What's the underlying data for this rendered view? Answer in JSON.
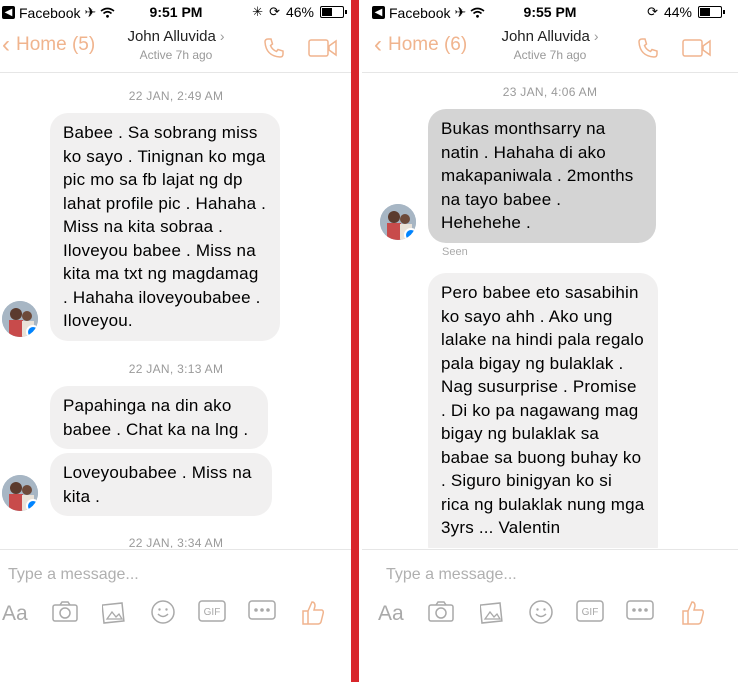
{
  "left": {
    "status": {
      "app": "Facebook",
      "time": "9:51 PM",
      "battery": "46%",
      "battery_level": 0.46
    },
    "nav": {
      "back": "Home (5)",
      "name": "John Alluvida",
      "active": "Active 7h ago"
    },
    "messages": [
      {
        "ts": "22 JAN, 2:49 AM"
      },
      {
        "text": "Babee . Sa sobrang miss ko sayo . Tinignan ko mga pic mo sa fb lajat ng dp lahat profile pic . Hahaha . Miss na kita sobraa . Iloveyou babee . Miss na kita ma txt ng magdamag . Hahaha iloveyoubabee . Iloveyou."
      },
      {
        "ts": "22 JAN, 3:13 AM"
      },
      {
        "text": "Papahinga na din ako babee . Chat ka na lng ."
      },
      {
        "text": "Loveyoubabee . Miss na kita ."
      },
      {
        "ts": "22 JAN, 3:34 AM"
      }
    ],
    "composer": {
      "placeholder": "Type a message..."
    }
  },
  "right": {
    "status": {
      "app": "Facebook",
      "time": "9:55 PM",
      "battery": "44%",
      "battery_level": 0.44
    },
    "nav": {
      "back": "Home (6)",
      "name": "John Alluvida",
      "active": "Active 7h ago"
    },
    "messages": [
      {
        "ts": "23 JAN, 4:06 AM"
      },
      {
        "text": "Bukas monthsarry na natin . Hahaha di ako makapaniwala . 2months na tayo babee . Hehehehe ."
      },
      {
        "seen": "Seen"
      },
      {
        "text": "Pero babee eto sasabihin ko sayo ahh . Ako ung lalake na hindi pala regalo pala bigay ng bulaklak . Nag susurprise . Promise . Di ko pa nagawang mag bigay ng bulaklak sa babae sa buong buhay ko . Siguro binigyan ko si rica ng bulaklak nung mga 3yrs ... Valentin"
      }
    ],
    "composer": {
      "placeholder": "Type a message..."
    }
  },
  "toolbar": {
    "aa": "Aa",
    "gif": "GIF"
  },
  "colors": {
    "accent": "#f0b48e",
    "divider": "#d8262b",
    "bubble": "#f1f0f0",
    "bubble_seen": "#d4d4d4",
    "messenger_badge": "#0084ff"
  }
}
